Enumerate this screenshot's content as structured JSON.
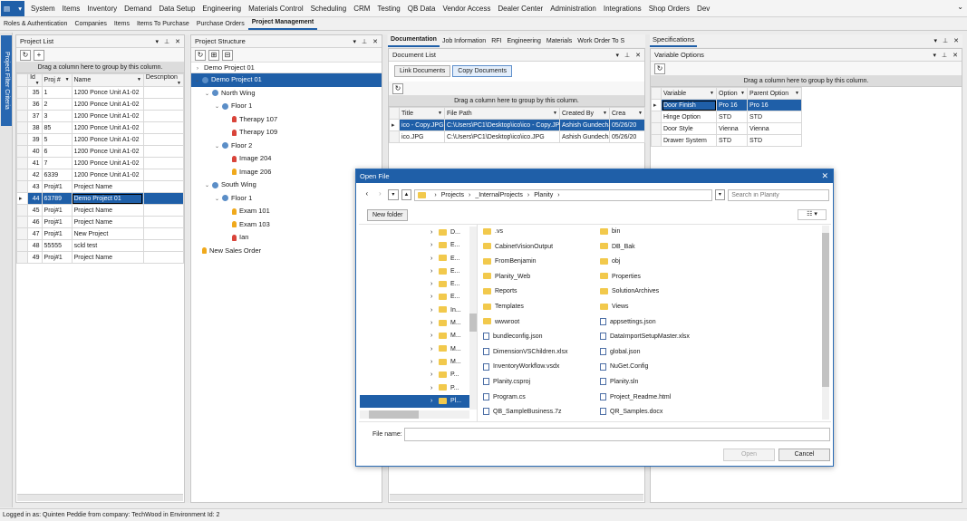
{
  "menu": [
    "System",
    "Items",
    "Inventory",
    "Demand",
    "Data Setup",
    "Engineering",
    "Materials Control",
    "Scheduling",
    "CRM",
    "Testing",
    "QB Data",
    "Vendor Access",
    "Dealer Center",
    "Administration",
    "Integrations",
    "Shop Orders",
    "Dev"
  ],
  "tabs": [
    "Roles & Authentication",
    "Companies",
    "Items",
    "Items To Purchase",
    "Purchase Orders",
    "Project Management"
  ],
  "side_tab": "Project Filter Criteria",
  "project_list": {
    "title": "Project List",
    "group_hint": "Drag a column here to group by this column.",
    "columns": [
      "Id",
      "Proj #",
      "Name",
      "Description"
    ],
    "rows": [
      [
        "35",
        "1",
        "1200 Ponce Unit A1-02",
        ""
      ],
      [
        "36",
        "2",
        "1200 Ponce Unit A1-02",
        ""
      ],
      [
        "37",
        "3",
        "1200 Ponce Unit A1-02",
        ""
      ],
      [
        "38",
        "85",
        "1200 Ponce Unit A1-02",
        ""
      ],
      [
        "39",
        "5",
        "1200 Ponce Unit A1-02",
        ""
      ],
      [
        "40",
        "6",
        "1200 Ponce Unit A1-02",
        ""
      ],
      [
        "41",
        "7",
        "1200 Ponce Unit A1-02",
        ""
      ],
      [
        "42",
        "6339",
        "1200 Ponce Unit A1-02",
        ""
      ],
      [
        "43",
        "Proj#1",
        "Project Name",
        ""
      ],
      [
        "44",
        "63789",
        "Demo Project 01",
        ""
      ],
      [
        "45",
        "Proj#1",
        "Project Name",
        ""
      ],
      [
        "46",
        "Proj#1",
        "Project Name",
        ""
      ],
      [
        "47",
        "Proj#1",
        "New Project",
        ""
      ],
      [
        "48",
        "55555",
        "scld test",
        ""
      ],
      [
        "49",
        "Proj#1",
        "Project Name",
        ""
      ]
    ]
  },
  "project_structure": {
    "title": "Project Structure",
    "header_item": "Demo Project 01",
    "items": [
      {
        "label": "Demo Project 01",
        "type": "dot"
      },
      {
        "label": "North Wing",
        "type": "dot"
      },
      {
        "label": "Floor 1",
        "type": "dot"
      },
      {
        "label": "Therapy 107",
        "type": "red"
      },
      {
        "label": "Therapy 109",
        "type": "red"
      },
      {
        "label": "Floor 2",
        "type": "dot"
      },
      {
        "label": "Image 204",
        "type": "red"
      },
      {
        "label": "Image 206",
        "type": "or"
      },
      {
        "label": "South Wing",
        "type": "dot"
      },
      {
        "label": "Floor 1",
        "type": "dot"
      },
      {
        "label": "Exam 101",
        "type": "or"
      },
      {
        "label": "Exam 103",
        "type": "or"
      },
      {
        "label": "Ian",
        "type": "red"
      },
      {
        "label": "New Sales Order",
        "type": "or"
      }
    ]
  },
  "doc_tabs": [
    "Documentation",
    "Job Information",
    "RFI",
    "Engineering",
    "Materials",
    "Work Order To S"
  ],
  "document_list": {
    "title": "Document List",
    "link_btn": "Link Documents",
    "copy_btn": "Copy Documents",
    "group_hint": "Drag a column here to group by this column.",
    "columns": [
      "Title",
      "File Path",
      "Created By",
      "Crea"
    ],
    "rows": [
      [
        "ico - Copy.JPG",
        "C:\\Users\\PC1\\Desktop\\ico\\ico - Copy.JPG",
        "Ashish Gundecha",
        "05/26/20"
      ],
      [
        "ico.JPG",
        "C:\\Users\\PC1\\Desktop\\ico\\ico.JPG",
        "Ashish Gundecha",
        "05/26/20"
      ]
    ]
  },
  "specifications": {
    "title": "Specifications",
    "sub_title": "Variable Options",
    "group_hint": "Drag a column here to group by this column.",
    "columns": [
      "Variable",
      "Option",
      "Parent Option"
    ],
    "rows": [
      [
        "Door Finish",
        "Pro 16",
        "Pro 16"
      ],
      [
        "Hinge Option",
        "STD",
        "STD"
      ],
      [
        "Door Style",
        "Vienna",
        "Vienna"
      ],
      [
        "Drawer System",
        "STD",
        "STD"
      ]
    ]
  },
  "open_file": {
    "title": "Open File",
    "path": [
      "Projects",
      "_InternalProjects",
      "Planity"
    ],
    "search_placeholder": "Search in Planity",
    "new_folder": "New folder",
    "filename_label": "File name:",
    "open_btn": "Open",
    "cancel_btn": "Cancel",
    "tree": [
      "D...",
      "E...",
      "E...",
      "E...",
      "E...",
      "E...",
      "In...",
      "M...",
      "M...",
      "M...",
      "M...",
      "P...",
      "P...",
      "Pl..."
    ],
    "files_left": [
      {
        "name": ".vs",
        "kind": "folder"
      },
      {
        "name": "CabinetVisionOutput",
        "kind": "folder"
      },
      {
        "name": "FromBenjamin",
        "kind": "folder"
      },
      {
        "name": "Planity_Web",
        "kind": "folder"
      },
      {
        "name": "Reports",
        "kind": "folder"
      },
      {
        "name": "Templates",
        "kind": "folder"
      },
      {
        "name": "wwwroot",
        "kind": "folder"
      },
      {
        "name": "bundleconfig.json",
        "kind": "file"
      },
      {
        "name": "DimensionVSChildren.xlsx",
        "kind": "file"
      },
      {
        "name": "InventoryWorkflow.vsdx",
        "kind": "file"
      },
      {
        "name": "Planity.csproj",
        "kind": "file"
      },
      {
        "name": "Program.cs",
        "kind": "file"
      },
      {
        "name": "QB_SampleBusiness.7z",
        "kind": "file"
      }
    ],
    "files_right": [
      {
        "name": "bin",
        "kind": "folder"
      },
      {
        "name": "DB_Bak",
        "kind": "folder"
      },
      {
        "name": "obj",
        "kind": "folder"
      },
      {
        "name": "Properties",
        "kind": "folder"
      },
      {
        "name": "SolutionArchives",
        "kind": "folder"
      },
      {
        "name": "Views",
        "kind": "folder"
      },
      {
        "name": "appsettings.json",
        "kind": "file"
      },
      {
        "name": "DataImportSetupMaster.xlsx",
        "kind": "file"
      },
      {
        "name": "global.json",
        "kind": "file"
      },
      {
        "name": "NuGet.Config",
        "kind": "file"
      },
      {
        "name": "Planity.sln",
        "kind": "file"
      },
      {
        "name": "Project_Readme.html",
        "kind": "file"
      },
      {
        "name": "QR_Samples.docx",
        "kind": "file"
      }
    ]
  },
  "status": "Logged in as: Quinten Peddie  from company: TechWood in Environment Id: 2",
  "colors": {
    "accent": "#1f5fa8",
    "folder": "#f2c94c"
  }
}
